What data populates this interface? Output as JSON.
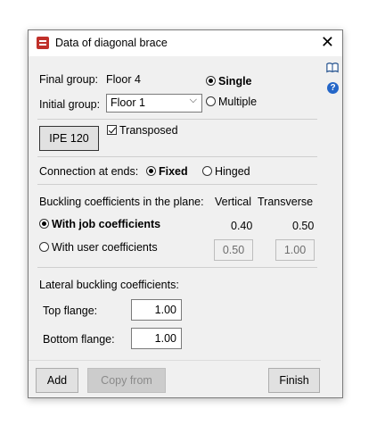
{
  "window": {
    "title": "Data of diagonal brace"
  },
  "groups": {
    "final_label": "Final group:",
    "final_value": "Floor 4",
    "initial_label": "Initial group:",
    "initial_value": "Floor 1",
    "single_label": "Single",
    "multiple_label": "Multiple",
    "selected_mode": "Single"
  },
  "profile": {
    "button_label": "IPE 120",
    "transposed_label": "Transposed",
    "transposed_checked": true
  },
  "connection": {
    "label": "Connection at ends:",
    "fixed_label": "Fixed",
    "hinged_label": "Hinged",
    "selected": "Fixed"
  },
  "buckling": {
    "heading": "Buckling coefficients in the plane:",
    "col_vertical": "Vertical",
    "col_transverse": "Transverse",
    "job_label": "With job coefficients",
    "job_vertical": "0.40",
    "job_transverse": "0.50",
    "user_label": "With user coefficients",
    "user_vertical": "0.50",
    "user_transverse": "1.00",
    "selected": "job"
  },
  "lateral": {
    "heading": "Lateral buckling coefficients:",
    "top_label": "Top flange:",
    "top_value": "1.00",
    "bottom_label": "Bottom flange:",
    "bottom_value": "1.00"
  },
  "footer": {
    "add_label": "Add",
    "copy_label": "Copy from",
    "finish_label": "Finish"
  },
  "icons": [
    "app-icon",
    "close-icon",
    "book-icon",
    "help-icon",
    "chevron-down-icon"
  ]
}
